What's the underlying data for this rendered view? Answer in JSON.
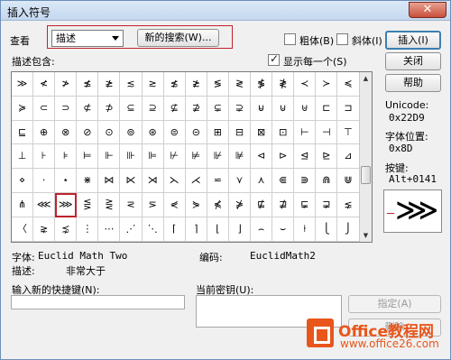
{
  "window": {
    "title": "插入符号",
    "close_label": "✕"
  },
  "toolbar": {
    "view_label": "查看",
    "view_value": "描述",
    "new_search_label": "新的搜索(W)...",
    "bold_label": "粗体(B)",
    "italic_label": "斜体(I)",
    "insert_label": "插入(I)",
    "close_label": "关闭",
    "help_label": "帮助"
  },
  "description_includes_label": "描述包含:",
  "show_each_label": "显示每一个(S)",
  "show_each_checked": true,
  "symbols": {
    "rows": [
      [
        "≫",
        "≮",
        "≯",
        "≰",
        "≱",
        "≲",
        "≳",
        "≴",
        "≵",
        "≶",
        "≷",
        "≸",
        "≹",
        "≺",
        "≻",
        "≼"
      ],
      [
        "≽",
        "⊂",
        "⊃",
        "⊄",
        "⊅",
        "⊆",
        "⊇",
        "⊈",
        "⊉",
        "⊊",
        "⊋",
        "⊌",
        "⊍",
        "⊎",
        "⊏",
        "⊐"
      ],
      [
        "⊑",
        "⊕",
        "⊗",
        "⊘",
        "⊙",
        "⊚",
        "⊛",
        "⊜",
        "⊝",
        "⊞",
        "⊟",
        "⊠",
        "⊡",
        "⊢",
        "⊣",
        "⊤"
      ],
      [
        "⊥",
        "⊦",
        "⊧",
        "⊨",
        "⊩",
        "⊪",
        "⊫",
        "⊬",
        "⊭",
        "⊮",
        "⊯",
        "⊲",
        "⊳",
        "⊴",
        "⊵",
        "⊿"
      ],
      [
        "⋄",
        "·",
        "⋆",
        "⋇",
        "⋈",
        "⋉",
        "⋊",
        "⋋",
        "⋌",
        "⋍",
        "⋎",
        "⋏",
        "⋐",
        "⋑",
        "⋒",
        "⋓"
      ],
      [
        "⋔",
        "⋘",
        "⋙",
        "⋚",
        "⋛",
        "⋜",
        "⋝",
        "⋞",
        "⋟",
        "⋠",
        "⋡",
        "⋢",
        "⋣",
        "⋤",
        "⋥",
        "⋦"
      ],
      [
        "〈",
        "⋧",
        "⋨",
        "⋮",
        "⋯",
        "⋰",
        "⋱",
        "⌈",
        "⌉",
        "⌊",
        "⌋",
        "⌢",
        "⌣",
        "⍿",
        "⎩",
        "⎭"
      ]
    ],
    "selected_row": 5,
    "selected_col": 2
  },
  "info": {
    "unicode_label": "Unicode:",
    "unicode_value": "0x22D9",
    "font_position_label": "字体位置:",
    "font_position_value": "0x8D",
    "keystroke_label": "按键:",
    "keystroke_value": "Alt+0141",
    "font_label": "字体:",
    "font_value": "Euclid Math Two",
    "encoding_label": "编码:",
    "encoding_value": "EuclidMath2",
    "description_label": "描述:",
    "description_value": "非常大于",
    "preview_glyph": "⋙"
  },
  "shortcut": {
    "new_label": "输入新的快捷键(N):",
    "current_label": "当前密钥(U):",
    "assign_label": "指定(A)",
    "remove_label": "删除"
  },
  "watermark": {
    "brand": "Office教程网",
    "url": "www.office26.com"
  },
  "colors": {
    "highlight": "#c0222c",
    "brand": "#e8561b"
  }
}
